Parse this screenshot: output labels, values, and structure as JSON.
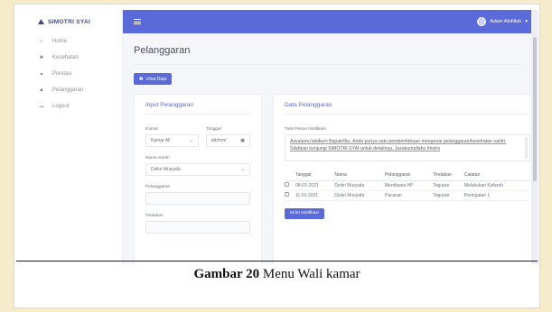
{
  "sidebar": {
    "brand": "SIMOTRI SYAI",
    "items": [
      {
        "icon": "home-icon",
        "glyph": "⌂",
        "label": "Home"
      },
      {
        "icon": "health-icon",
        "glyph": "♣",
        "label": "Kesehatan"
      },
      {
        "icon": "trophy-icon",
        "glyph": "▾",
        "label": "Prestasi"
      },
      {
        "icon": "warning-icon",
        "glyph": "▲",
        "label": "Pelanggaran"
      },
      {
        "icon": "logout-icon",
        "glyph": "↦",
        "label": "Logout"
      }
    ]
  },
  "topbar": {
    "user_name": "Adam Abdillah"
  },
  "page": {
    "title": "Pelanggaran",
    "lihat_data_button": "Lihat Data"
  },
  "input_card": {
    "title": "Input Pelanggaran",
    "kamar_label": "Kamar",
    "kamar_value": "Kamar Ali",
    "tanggal_label": "Tanggal",
    "tanggal_value": "dd/mm/",
    "nama_santri_label": "Nama Santri",
    "nama_santri_value": "Dzikri Musyafa",
    "pelanggaran_label": "Pelanggaran",
    "tindakan_label": "Tindakan"
  },
  "data_card": {
    "title": "Data Pelanggaran",
    "notif_label": "Tulis Pesan Notifikasi",
    "notif_text": "Assalamu'alaikum Bapak/Ibu, Anda punya satu pemberitahuan mengenai pelanggaran/kesehatan santri. Silahkan kunjungi SIMOTRI SYAI untuk detailnya. Jazakumullahu khoiro",
    "columns": [
      "Tanggal",
      "Nama",
      "Pelanggaran",
      "Tindakan",
      "Catatan"
    ],
    "rows": [
      [
        "08-01-2021",
        "Dzikri Musyafa",
        "Membawa HP",
        "Teguran",
        "Melakukan Kafaroh"
      ],
      [
        "11-01-2021",
        "Dzikri Musyafa",
        "Pacaran",
        "Teguran",
        "Peringatan 1"
      ]
    ],
    "send_button": "Kirim Notifikasi"
  },
  "caption": {
    "bold": "Gambar 20",
    "text": " Menu Wali kamar"
  }
}
